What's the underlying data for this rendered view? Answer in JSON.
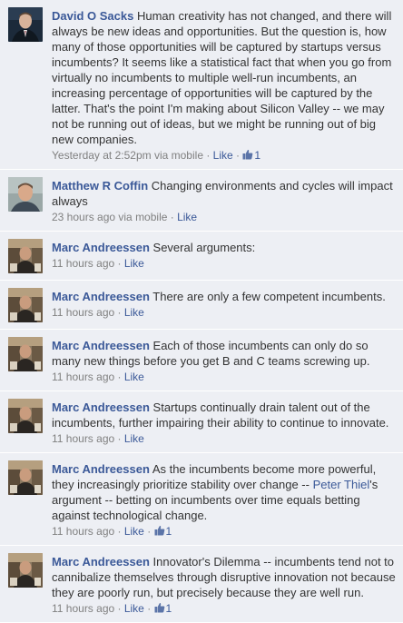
{
  "separator": " · ",
  "comments": [
    {
      "author": "David O Sacks",
      "text": "Human creativity has not changed, and there will always be new ideas and opportunities. But the question is, how many of those opportunities will be captured by startups versus incumbents? It seems like a statistical fact that when you go from virtually no incumbents to multiple well-run incumbents, an increasing percentage of opportunities will be captured by the latter. That's the point I'm making about Silicon Valley -- we may not be running out of ideas, but we might be running out of big new companies.",
      "time": "Yesterday at 2:52pm via mobile",
      "like_label": "Like",
      "like_count": "1"
    },
    {
      "author": "Matthew R Coffin",
      "text": "Changing environments and cycles will impact always",
      "time": "23 hours ago via mobile",
      "like_label": "Like"
    },
    {
      "author": "Marc Andreessen",
      "text": "Several arguments:",
      "time": "11 hours ago",
      "like_label": "Like"
    },
    {
      "author": "Marc Andreessen",
      "text": "There are only a few competent incumbents.",
      "time": "11 hours ago",
      "like_label": "Like"
    },
    {
      "author": "Marc Andreessen",
      "text": "Each of those incumbents can only do so many new things before you get B and C teams screwing up.",
      "time": "11 hours ago",
      "like_label": "Like"
    },
    {
      "author": "Marc Andreessen",
      "text": "Startups continually drain talent out of the incumbents, further impairing their ability to continue to innovate.",
      "time": "11 hours ago",
      "like_label": "Like"
    },
    {
      "author": "Marc Andreessen",
      "text_before": "As the incumbents become more powerful, they increasingly prioritize stability over change -- ",
      "mention": "Peter Thiel",
      "text_after": "'s argument -- betting on incumbents over time equals betting against technological change.",
      "time": "11 hours ago",
      "like_label": "Like",
      "like_count": "1"
    },
    {
      "author": "Marc Andreessen",
      "text": "Innovator's Dilemma -- incumbents tend not to cannibalize themselves through disruptive innovation not because they are poorly run, but precisely because they are well run.",
      "time": "11 hours ago",
      "like_label": "Like",
      "like_count": "1"
    }
  ],
  "icons": {
    "like_count": "thumbs-up-icon"
  },
  "colors": {
    "link": "#3b5998",
    "comment_bg": "#edeff4",
    "meta": "#808080"
  }
}
